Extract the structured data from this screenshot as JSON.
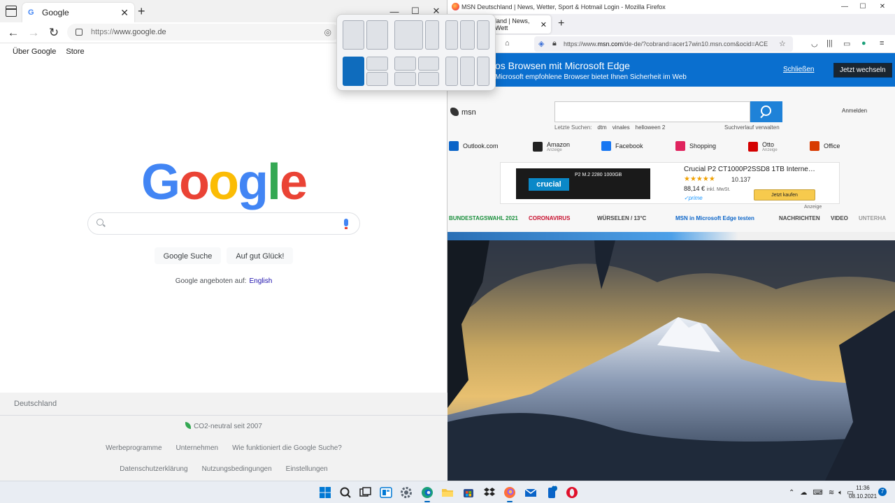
{
  "edge": {
    "tab_title": "Google",
    "url_prefix": "https://",
    "url_host": "www.google.de",
    "new_tab": "+",
    "tab_close": "✕",
    "minimize": "—",
    "maximize": "☐",
    "close": "✕"
  },
  "google": {
    "top_links": [
      "Über Google",
      "Store"
    ],
    "logo_letters": [
      {
        "char": "G",
        "color": "#4285f4"
      },
      {
        "char": "o",
        "color": "#ea4335"
      },
      {
        "char": "o",
        "color": "#fbbc05"
      },
      {
        "char": "g",
        "color": "#4285f4"
      },
      {
        "char": "l",
        "color": "#34a853"
      },
      {
        "char": "e",
        "color": "#ea4335"
      }
    ],
    "search_button": "Google Suche",
    "lucky_button": "Auf gut Glück!",
    "offered_in": "Google angeboten auf:",
    "language_link": "English",
    "footer": {
      "country": "Deutschland",
      "co2": "CO2-neutral seit 2007",
      "links_row1": [
        "Werbeprogramme",
        "Unternehmen",
        "Wie funktioniert die Google Suche?"
      ],
      "links_row2": [
        "Datenschutzerklärung",
        "Nutzungsbedingungen",
        "Einstellungen"
      ]
    }
  },
  "firefox": {
    "window_title": "MSN Deutschland | News, Wetter, Sport & Hotmail Login - Mozilla Firefox",
    "tab_title": "land | News, Wett",
    "url_prefix": "https://www.",
    "url_host": "msn.com",
    "url_rest": "/de-de/?cobrand=acer17win10.msn.com&ocid=ACE"
  },
  "msn": {
    "banner_title": "os Browsen mit Microsoft Edge",
    "banner_sub": "Microsoft empfohlene Browser bietet Ihnen Sicherheit im Web",
    "banner_link": "Schließen",
    "banner_button": "Jetzt wechseln",
    "logo": "msn",
    "recent_label": "Letzte Suchen:",
    "recent_items": [
      "dtm",
      "vinales",
      "helloween 2"
    ],
    "history_link": "Suchverlauf verwalten",
    "signin": "Anmelden",
    "quick_links": [
      {
        "label": "Outlook.com",
        "sub": "",
        "color": "#0a64c8"
      },
      {
        "label": "Amazon",
        "sub": "Anzeige",
        "color": "#222222"
      },
      {
        "label": "Facebook",
        "sub": "",
        "color": "#1877f2"
      },
      {
        "label": "Shopping",
        "sub": "",
        "color": "#e0245e"
      },
      {
        "label": "Otto",
        "sub": "Anzeige",
        "color": "#d40000"
      },
      {
        "label": "Office",
        "sub": "",
        "color": "#d83b01"
      }
    ],
    "ad": {
      "title": "Crucial P2 CT1000P2SSD8 1TB Internes ...",
      "reviews": "10.137",
      "rating": 4.5,
      "price": "88,14 €",
      "price_note": "inkl. MwSt.",
      "prime": "✓prime",
      "buy": "Jetzt kaufen",
      "label": "Anzeige",
      "brand": "crucial",
      "model": "P2 M.2 2280   1000GB"
    },
    "news_nav": [
      {
        "label": "BUNDESTAGSWAHL 2021",
        "color": "#1a8f3c"
      },
      {
        "label": "CORONAVIRUS",
        "color": "#c8102e"
      },
      {
        "label": "WÜRSELEN / 13°C",
        "color": "#444444"
      },
      {
        "label": "MSN in Microsoft Edge testen",
        "color": "#0a64c8"
      },
      {
        "label": "NACHRICHTEN",
        "color": "#444444"
      },
      {
        "label": "VIDEO",
        "color": "#444444"
      },
      {
        "label": "UNTERHA",
        "color": "#999999"
      }
    ]
  },
  "taskbar": {
    "time": "11:36",
    "date": "08.10.2021",
    "notifications": "7",
    "store_badge": "1"
  }
}
